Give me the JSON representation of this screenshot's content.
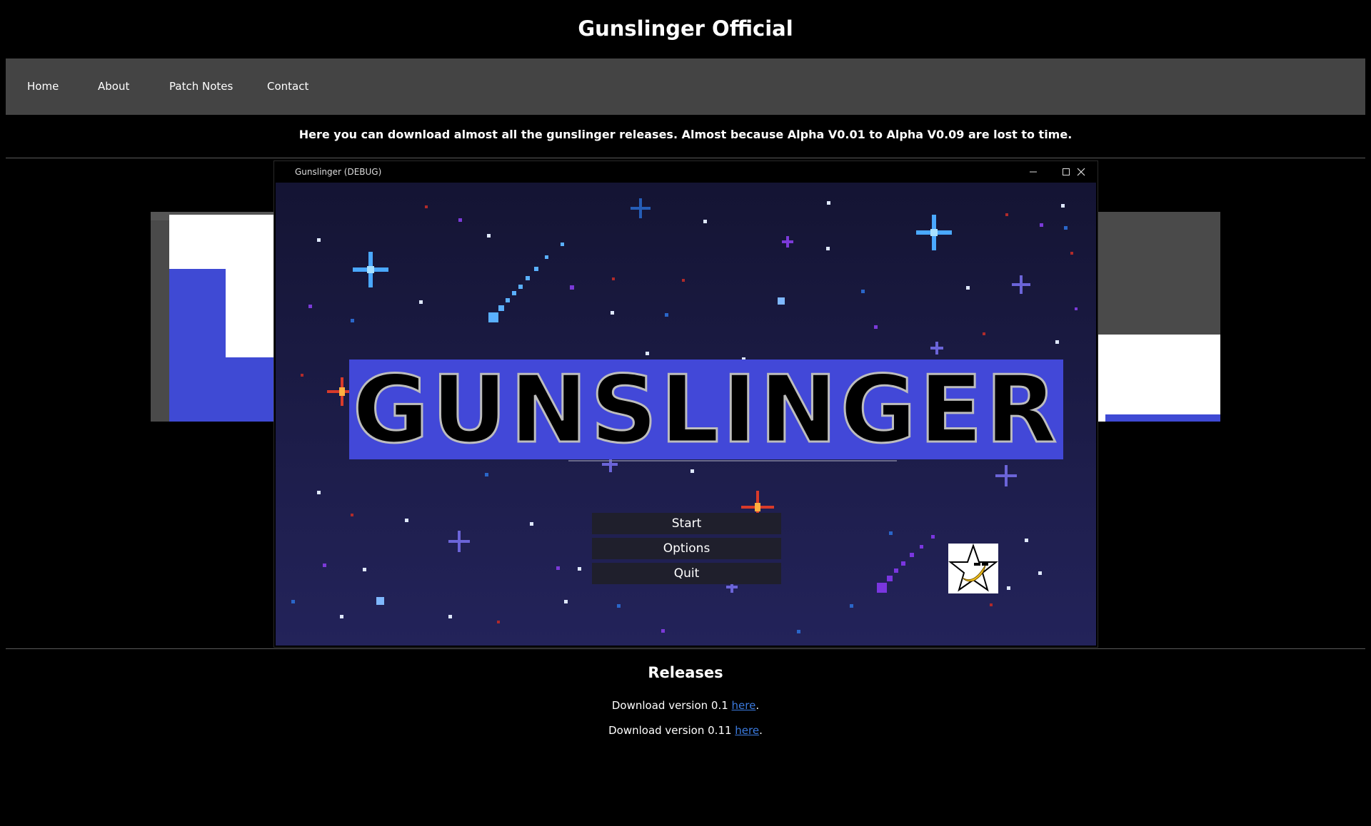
{
  "site": {
    "title": "Gunslinger Official"
  },
  "nav": {
    "items": [
      {
        "label": "Home"
      },
      {
        "label": "About"
      },
      {
        "label": "Patch Notes"
      },
      {
        "label": "Contact"
      }
    ]
  },
  "intro": "Here you can download almost all the gunslinger releases. Almost because Alpha V0.01 to Alpha V0.09 are lost to time.",
  "game_window": {
    "title": "Gunslinger (DEBUG)",
    "controls": {
      "minimize_icon": "minimize-icon",
      "maximize_icon": "maximize-icon",
      "close_icon": "close-icon"
    },
    "logo": "GUNSLINGER",
    "menu": [
      {
        "label": "Start"
      },
      {
        "label": "Options"
      },
      {
        "label": "Quit"
      }
    ],
    "colors": {
      "sky_top": "#141433",
      "sky_bottom": "#23235a",
      "logo_band": "#4248d8"
    }
  },
  "releases": {
    "title": "Releases",
    "items": [
      {
        "prefix": "Download version 0.1 ",
        "link": "here",
        "suffix": "."
      },
      {
        "prefix": "Download version 0.11 ",
        "link": "here",
        "suffix": "."
      }
    ]
  }
}
